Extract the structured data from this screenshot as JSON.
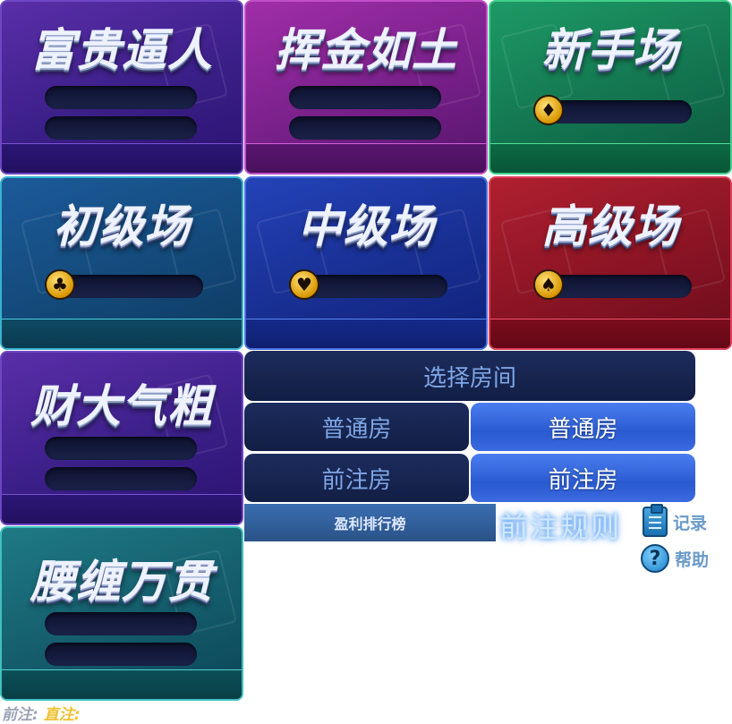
{
  "rooms": {
    "fugui": {
      "title": "富贵逼人"
    },
    "huijin": {
      "title": "挥金如土"
    },
    "xinshou": {
      "title": "新手场",
      "suit": "diamond-icon",
      "suit_glyph": "♦"
    },
    "chuji": {
      "title": "初级场",
      "suit": "club-icon",
      "suit_glyph": "♣"
    },
    "zhongji": {
      "title": "中级场",
      "suit": "heart-icon",
      "suit_glyph": "♥"
    },
    "gaoji": {
      "title": "高级场",
      "suit": "spade-icon",
      "suit_glyph": "♠"
    },
    "caida": {
      "title": "财大气粗"
    },
    "yaochan": {
      "title": "腰缠万贯"
    }
  },
  "panel": {
    "select_room": "选择房间",
    "normal_room": "普通房",
    "normal_room_active": "普通房",
    "bet_room": "前注房",
    "bet_room_active": "前注房",
    "leaderboard": "盈利排行榜",
    "bet_rules": "前注规则",
    "record": "记录",
    "help": "帮助"
  },
  "footer": {
    "label_a": "前注:",
    "label_b": "直注:"
  },
  "colors": {
    "accent_blue": "#2a5ad0",
    "chip_gold": "#d99600",
    "label_grey": "#9aa4b4",
    "label_gold": "#f0c030"
  }
}
